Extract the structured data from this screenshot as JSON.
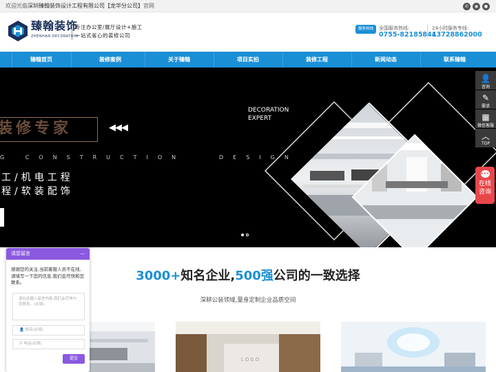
{
  "topbar": {
    "greeting": "欢迎光临",
    "company": "深圳臻翰装饰设计工程有限公司【龙华分公司】",
    "suffix": "官网"
  },
  "logo": {
    "name_cn": "臻翰装饰",
    "name_en": "ZHENHAN DECORATION"
  },
  "slogan": {
    "line1": "专注办公室/展厅设计+施工",
    "line2": "一站式省心的装修公司"
  },
  "hotline": {
    "badge": "服务热线",
    "national_label": "全国服务热线:",
    "national_number": "0755-82185844",
    "hours_label": "24小时服务专线:",
    "hours_number": "13728862000"
  },
  "nav": {
    "items": [
      "臻翰首页",
      "装修案例",
      "关于臻翰",
      "项目实拍",
      "装修工程",
      "新闻动态",
      "联系臻翰"
    ],
    "active_index": 0
  },
  "banner": {
    "title": "装修专家",
    "arrows": "◀◀◀",
    "deco_line1": "DECORATION",
    "deco_line2": "EXPERT",
    "construction": "G CONSTRUCTION",
    "design": "DESIGN",
    "line1": "工/机电工程",
    "line2": "程/软装配饰",
    "slide_count": 2,
    "active_slide": 0
  },
  "right_toolbar": {
    "items": [
      {
        "label": "咨询",
        "icon": "person-icon"
      },
      {
        "label": "需求",
        "icon": "edit-icon"
      },
      {
        "label": "微信客服",
        "icon": "qrcode-icon"
      },
      {
        "label": "TOP",
        "icon": "chevron-up-icon"
      }
    ],
    "online_line1": "在线",
    "online_line2": "咨询"
  },
  "section": {
    "num1": "3000+",
    "text1": "知名企业,",
    "num2": "500强",
    "text2": "公司的一致选择",
    "subtitle": "深耕公装领域,量身定制企业品质空间"
  },
  "chat": {
    "title": "请您留言",
    "minimize": "—",
    "message": "感谢您的关注,当前客服人员不在线,请填写一下您的信息,我们会尽快和您联系。",
    "textarea_placeholder": "请在此输入留言内容,我们会尽快与您联系。(必填)",
    "name_placeholder": "姓名(必填)",
    "phone_placeholder": "电话(必填)",
    "submit": "提交"
  },
  "colors": {
    "brand_blue": "#1b8fd6",
    "chat_purple": "#8a59e0",
    "online_red": "#e8474a",
    "logo_navy": "#1a2f5a"
  }
}
